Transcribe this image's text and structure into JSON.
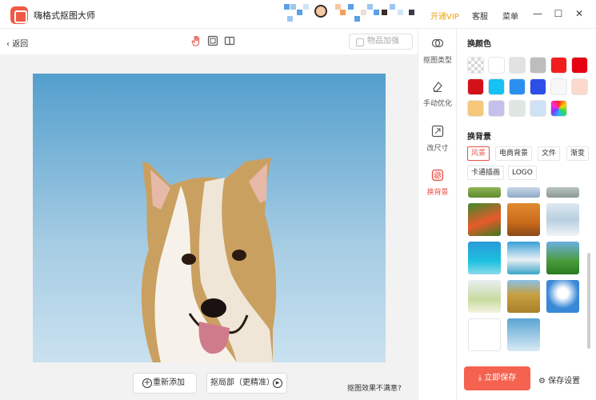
{
  "app": {
    "title": "嗨格式抠图大师"
  },
  "titlebar": {
    "vip": "开通VIP",
    "service": "客服",
    "menu": "菜单"
  },
  "toolbar": {
    "back": "返回",
    "goods_enhance": "物品加强"
  },
  "bottom": {
    "re_add": "重新添加",
    "partial": "抠局部（更精准）",
    "hint": "抠图效果不满意?"
  },
  "strip": {
    "items": [
      {
        "label": "抠图类型"
      },
      {
        "label": "手动优化"
      },
      {
        "label": "改尺寸"
      },
      {
        "label": "换背景"
      }
    ]
  },
  "panel": {
    "color_title": "换颜色",
    "swatches": [
      "transparent",
      "#ffffff",
      "#e2e2e2",
      "#bdbdbd",
      "#f21d1d",
      "#e60012",
      "#d3111a",
      "#16c2f3",
      "#2b8fef",
      "#2d4fe8",
      "#f7f7f7",
      "#fbd9cc",
      "#f7c77c",
      "#c3c0ec",
      "#dfe6e0",
      "#cfe2f5",
      "rainbow"
    ],
    "bg_title": "换背景",
    "tags": [
      "风景",
      "电商背景",
      "文件",
      "渐变",
      "卡通插画",
      "LOGO"
    ],
    "save": "立即保存",
    "save_settings": "保存设置"
  },
  "colors": {
    "accent": "#e8524a",
    "save": "#f5624f",
    "vip": "#f0a500"
  }
}
